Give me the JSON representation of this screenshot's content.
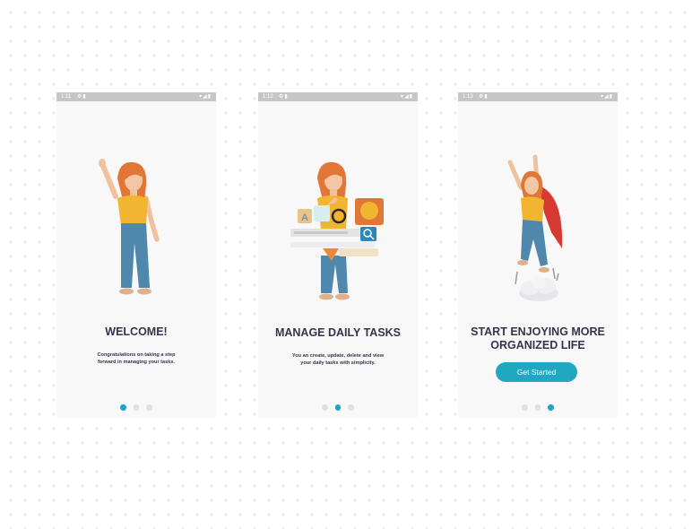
{
  "screens": [
    {
      "status": {
        "time": "1:11"
      },
      "title_lines": [
        "WELCOME!"
      ],
      "description_lines": [
        "Congratulations on taking a step",
        "forward in managing your tasks."
      ],
      "page_indicator": {
        "total": 3,
        "active": 1
      }
    },
    {
      "status": {
        "time": "1:12"
      },
      "title_lines": [
        "MANAGE DAILY TASKS"
      ],
      "description_lines": [
        "You an create, update, delete and view",
        "your daily tasks with simplicity."
      ],
      "page_indicator": {
        "total": 3,
        "active": 2
      }
    },
    {
      "status": {
        "time": "1:13"
      },
      "title_lines": [
        "START ENJOYING MORE",
        "ORGANIZED LIFE"
      ],
      "description_lines": [],
      "button_label": "Get Started",
      "page_indicator": {
        "total": 3,
        "active": 3
      }
    }
  ],
  "colors": {
    "accent": "#1aa6c4",
    "title_text": "#34344e",
    "screen_bg": "#f8f8f9",
    "status_bar": "#c6c6c6",
    "inactive_dot": "#e0e0e4",
    "hair": "#e27636",
    "shirt": "#f2b531",
    "pants": "#4f87ad",
    "cape": "#d63a32"
  },
  "icons": {
    "status_left": [
      "settings-icon",
      "sim-icon"
    ],
    "status_right": [
      "wifi-icon",
      "signal-icon",
      "battery-icon"
    ]
  }
}
